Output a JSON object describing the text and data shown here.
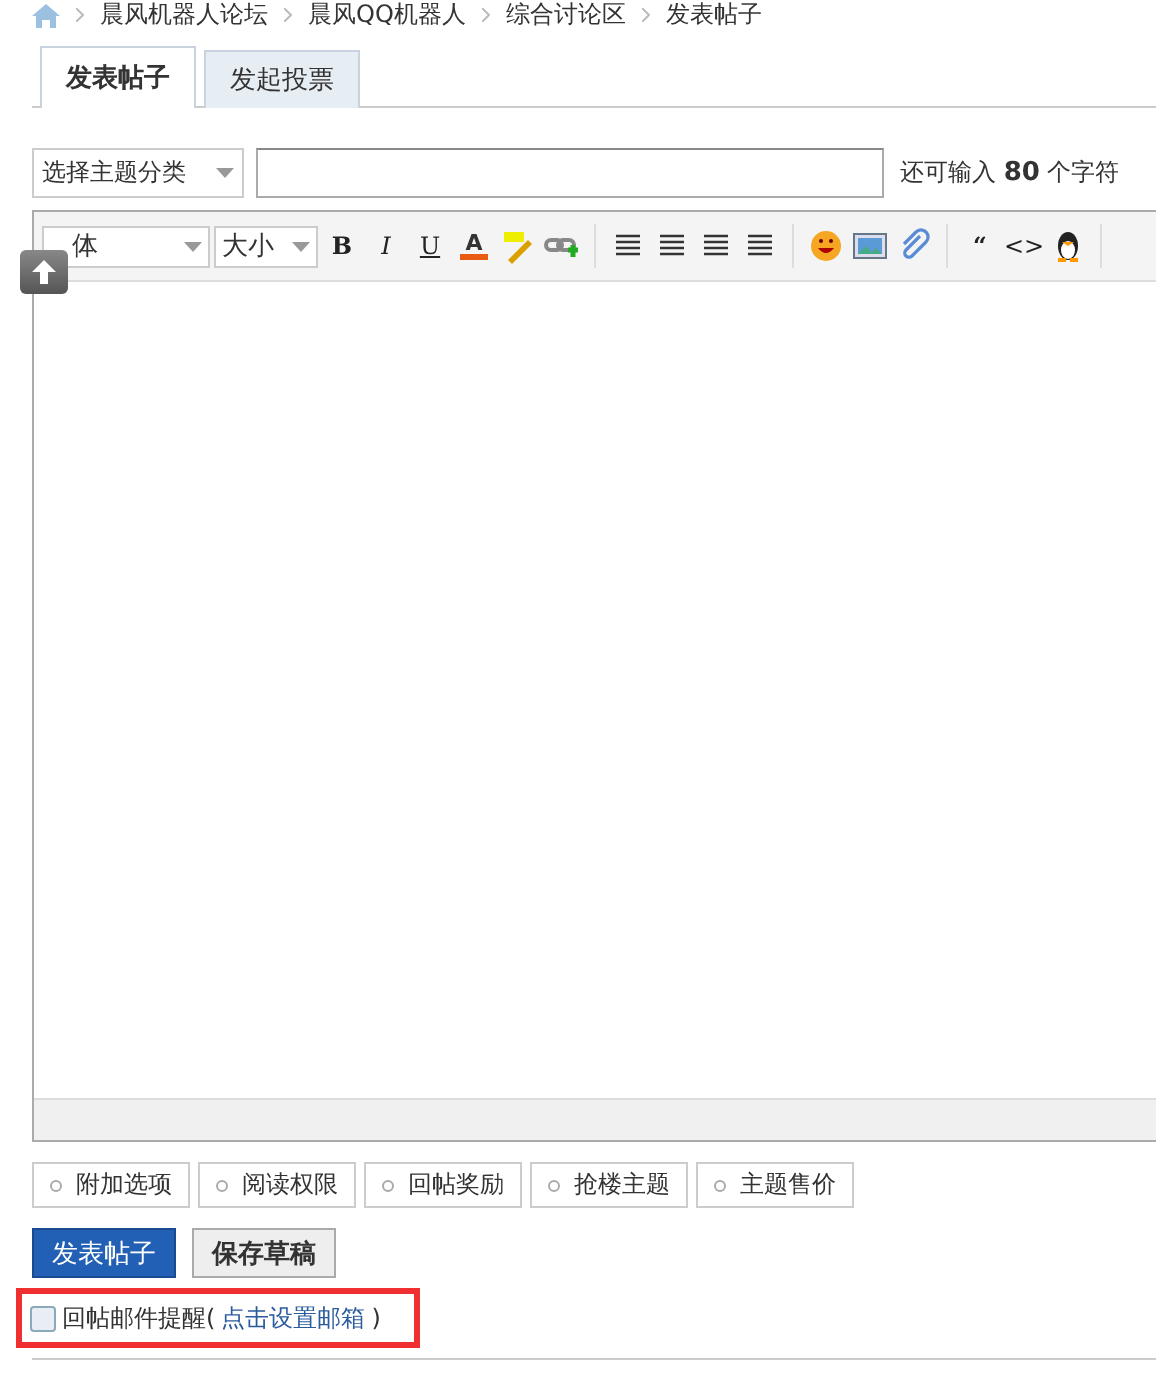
{
  "breadcrumb": [
    "晨风机器人论坛",
    "晨风QQ机器人",
    "综合讨论区",
    "发表帖子"
  ],
  "tabs": [
    {
      "label": "发表帖子",
      "selected": true
    },
    {
      "label": "发起投票",
      "selected": false
    }
  ],
  "subject": {
    "category": "选择主题分类",
    "char_hint": "还可输入 **80** 个字符"
  },
  "toolbar": [
    {
      "kind": "select",
      "label": "体"
    },
    {
      "kind": "select",
      "label": "大小"
    },
    {
      "kind": "bold",
      "label": "B"
    },
    {
      "kind": "italic",
      "label": "I"
    },
    {
      "kind": "underline",
      "label": "U"
    },
    {
      "kind": "color",
      "label": "A"
    },
    {
      "kind": "highlight"
    },
    {
      "kind": "link"
    },
    {
      "kind": "sep"
    },
    {
      "kind": "align"
    },
    {
      "kind": "align"
    },
    {
      "kind": "align"
    },
    {
      "kind": "align"
    },
    {
      "kind": "sep"
    },
    {
      "kind": "smiley"
    },
    {
      "kind": "image"
    },
    {
      "kind": "attach"
    },
    {
      "kind": "sep"
    },
    {
      "kind": "quote",
      "label": "“"
    },
    {
      "kind": "code",
      "label": "<>"
    },
    {
      "kind": "penguin"
    },
    {
      "kind": "sep"
    }
  ],
  "options": [
    "附加选项",
    "阅读权限",
    "回帖奖励",
    "抢楼主题",
    "主题售价"
  ],
  "buttons": [
    {
      "label": "发表帖子",
      "kind": "primary"
    },
    {
      "label": "保存草稿",
      "kind": "secondary"
    }
  ],
  "notify": {
    "checked": false,
    "label": "回帖邮件提醒(",
    "link": "点击设置邮箱",
    "suffix": ")"
  }
}
